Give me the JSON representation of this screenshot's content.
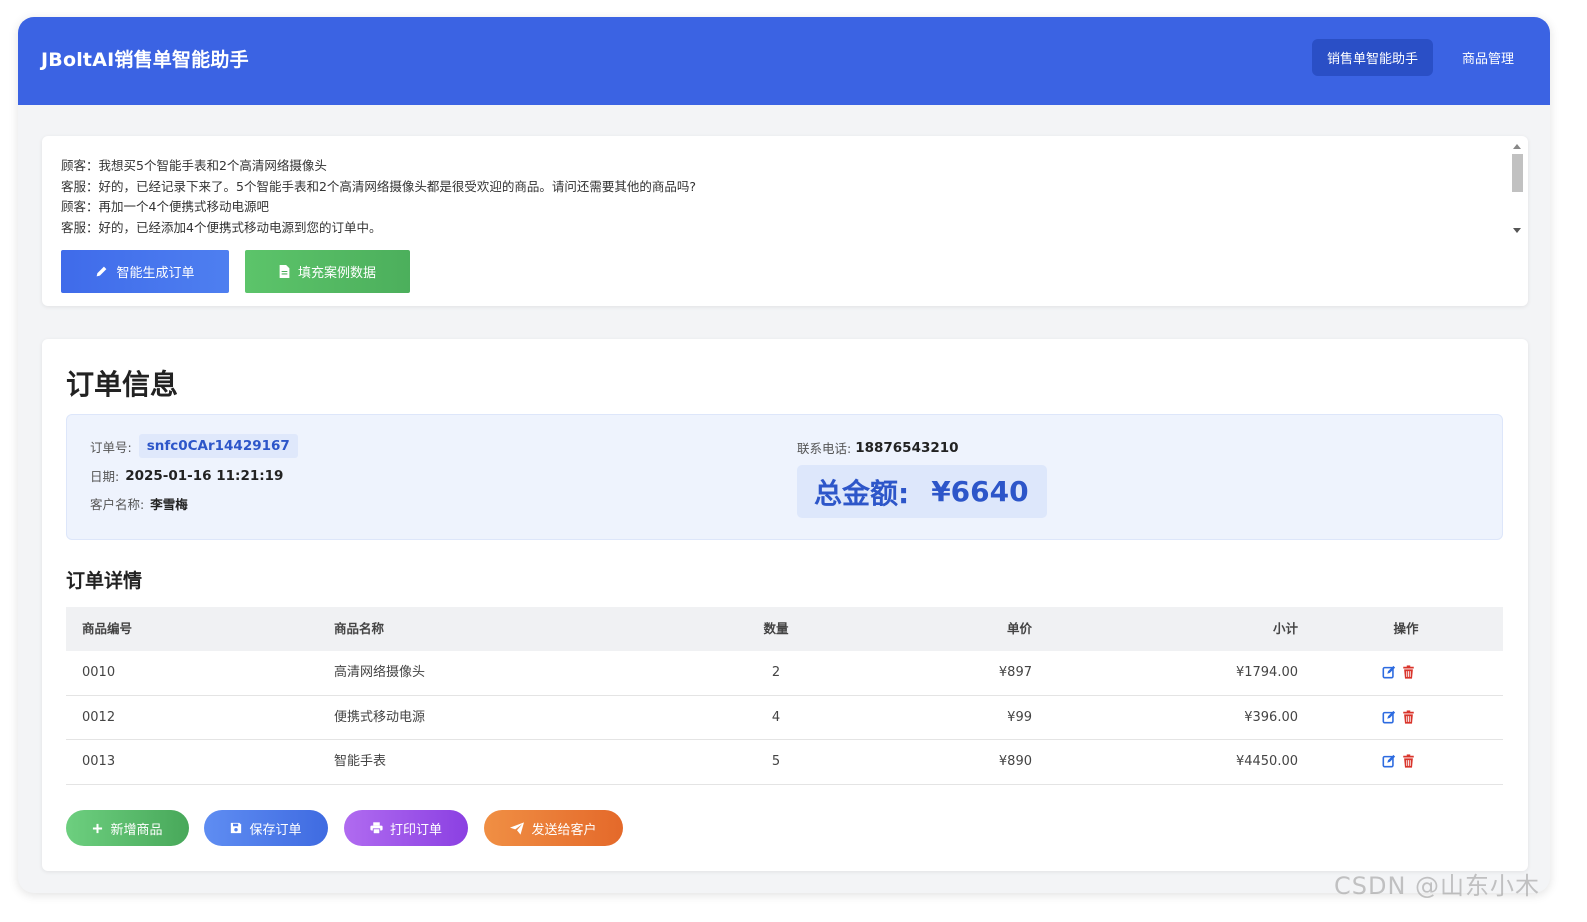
{
  "header": {
    "brand": "JBoltAI销售单智能助手",
    "nav": [
      {
        "label": "销售单智能助手",
        "active": true
      },
      {
        "label": "商品管理",
        "active": false
      }
    ]
  },
  "chat": {
    "lines": [
      "顾客：我想买5个智能手表和2个高清网络摄像头",
      "客服：好的，已经记录下来了。5个智能手表和2个高清网络摄像头都是很受欢迎的商品。请问还需要其他的商品吗?",
      "顾客：再加一个4个便携式移动电源吧",
      "客服：好的，已经添加4个便携式移动电源到您的订单中。"
    ],
    "generate_button": "智能生成订单",
    "fill_button": "填充案例数据"
  },
  "order": {
    "title": "订单信息",
    "order_no_label": "订单号:",
    "order_no": "snfc0CAr14429167",
    "date_label": "日期:",
    "date": "2025-01-16 11:21:19",
    "customer_label": "客户名称:",
    "customer": "李雪梅",
    "phone_label": "联系电话:",
    "phone": "18876543210",
    "total_label": "总金额:",
    "total": "¥6640"
  },
  "details": {
    "title": "订单详情",
    "columns": [
      "商品编号",
      "商品名称",
      "数量",
      "单价",
      "小计",
      "操作"
    ],
    "rows": [
      {
        "code": "0010",
        "name": "高清网络摄像头",
        "qty": "2",
        "price": "¥897",
        "subtotal": "¥1794.00"
      },
      {
        "code": "0012",
        "name": "便携式移动电源",
        "qty": "4",
        "price": "¥99",
        "subtotal": "¥396.00"
      },
      {
        "code": "0013",
        "name": "智能手表",
        "qty": "5",
        "price": "¥890",
        "subtotal": "¥4450.00"
      }
    ]
  },
  "actions": {
    "add": "新增商品",
    "save": "保存订单",
    "print": "打印订单",
    "send": "发送给客户"
  },
  "watermark": "CSDN @山东小木",
  "colors": {
    "primary": "#3b63e3",
    "accent_blue": "#2d56c9",
    "green": "#4caf5c",
    "purple": "#8b40e2",
    "orange": "#e4692a",
    "delete_red": "#d9342b"
  }
}
